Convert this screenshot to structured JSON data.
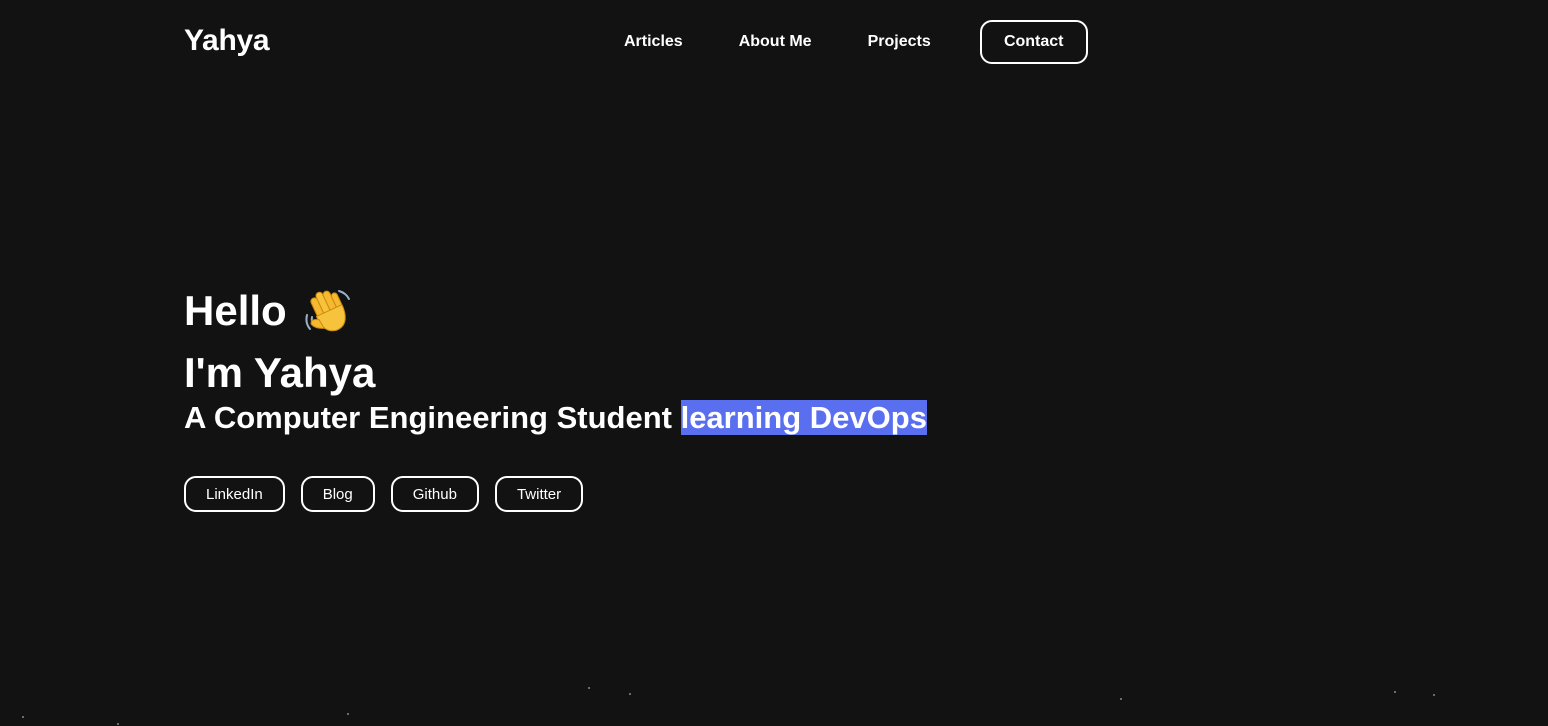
{
  "header": {
    "logo": "Yahya",
    "nav": {
      "articles": "Articles",
      "about": "About Me",
      "projects": "Projects",
      "contact": "Contact"
    }
  },
  "hero": {
    "greeting": "Hello",
    "greeting_icon": "waving-hand-emoji",
    "name_line": "I'm Yahya",
    "tagline_prefix": "A Computer Engineering Student ",
    "tagline_highlight": "learning DevOps",
    "highlight_color": "#5a6ff0",
    "socials": {
      "linkedin": "LinkedIn",
      "blog": "Blog",
      "github": "Github",
      "twitter": "Twitter"
    }
  },
  "theme": {
    "background": "#121212",
    "text": "#ffffff"
  }
}
